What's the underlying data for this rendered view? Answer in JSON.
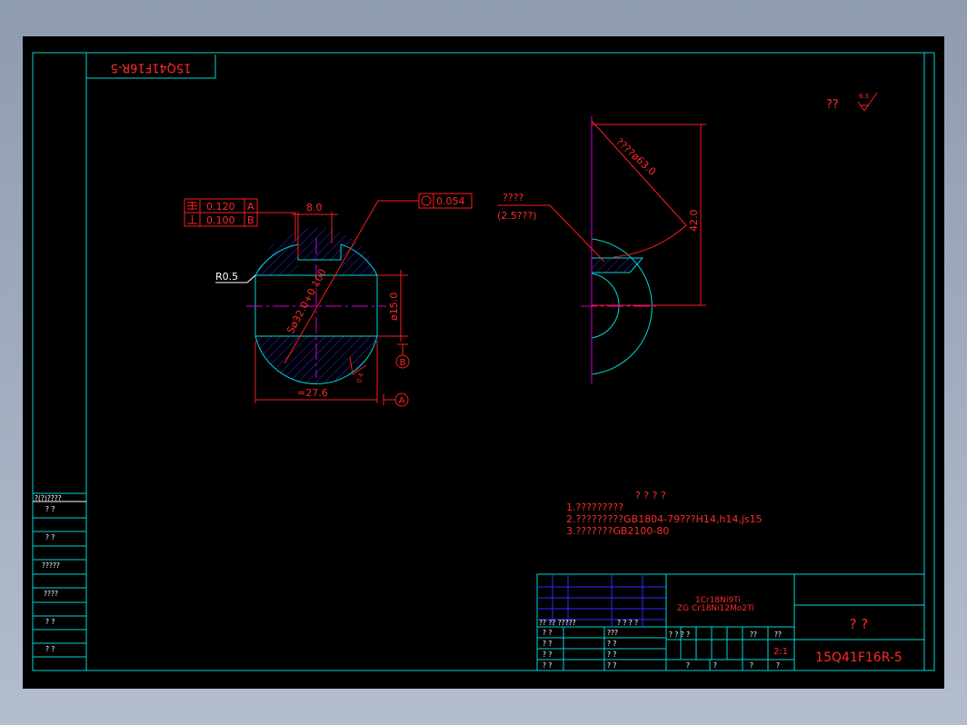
{
  "drawing": {
    "part_number_stamp": "15Q41F16R-5",
    "roughness_prefix": "??",
    "roughness_value": "6.3",
    "gdt": {
      "row1_tol": "0.120",
      "row1_ref": "A",
      "row2_tol": "0.100",
      "row2_ref": "B",
      "circularity_tol": "0.054"
    },
    "dims": {
      "slot_width": "8.0",
      "fillet": "R0.5",
      "sphere_dia": "Sø32.0+0.100",
      "flat_dia": "ø15.0",
      "width": "=27.6",
      "datum_a": "A",
      "datum_b": "B",
      "local_roughness": "0.4",
      "section_label": "????",
      "section_note": "(2.5???)",
      "hole_label": "????ø63.0",
      "height": "42.0"
    },
    "notes": {
      "title": "? ? ? ?",
      "line1": "1.?????????",
      "line2": "2.?????????GB1804-79???H14,h14,js15",
      "line3": "3.???????GB2100-80"
    },
    "title_block": {
      "material_1": "1Cr18Ni9Ti",
      "material_2": "ZG Cr18Ni12Mo2Ti",
      "part_name": "? ?",
      "drawing_number": "15Q41F16R-5",
      "scale": "2:1",
      "hdr1": "?? ?? ?????",
      "hdr2": "? ? ? ?",
      "r1a": "? ?",
      "r1b": "???",
      "r2a": "? ?",
      "r2b": "? ?",
      "r3a": "? ?",
      "r3b": "? ?",
      "r4a": "? ?",
      "r4b": "? ?",
      "mid_hdr": "? ? ? ?",
      "mid_c1": "??",
      "mid_c2": "??",
      "b1": "?",
      "b2": "?",
      "b3": "?",
      "b4": "?"
    },
    "left_strip": {
      "head": "?(?)????",
      "c1": "?  ?",
      "c2": "?  ?",
      "c3": "?????",
      "c4": "????",
      "c5": "?  ?",
      "c6": "?  ?"
    }
  },
  "colors": {
    "frame": "#00d6d6",
    "annotation": "#ff2a2a",
    "hatch": "#2c2cff",
    "centerline": "#d000d0"
  }
}
